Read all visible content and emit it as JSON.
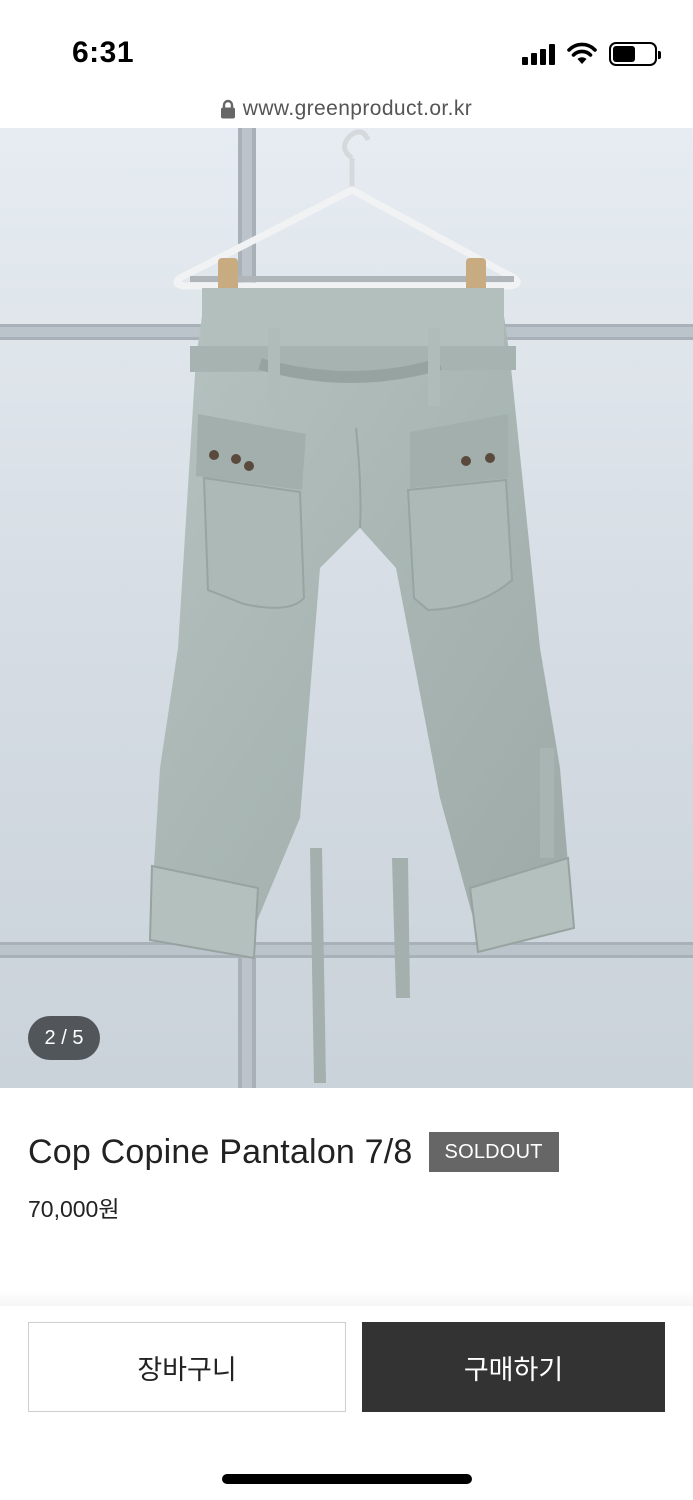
{
  "status_bar": {
    "time": "6:31",
    "icons": [
      "signal-icon",
      "wifi-icon",
      "battery-icon"
    ]
  },
  "browser": {
    "url": "www.greenproduct.or.kr",
    "lock_icon": "lock-icon"
  },
  "gallery": {
    "counter": "2 / 5",
    "current": 2,
    "total": 5
  },
  "product": {
    "name": "Cop Copine Pantalon 7/8",
    "badge": "SOLDOUT",
    "price": "70,000원"
  },
  "actions": {
    "cart_label": "장바구니",
    "buy_label": "구매하기"
  },
  "colors": {
    "buy_button": "#333333",
    "badge": "#666666"
  }
}
